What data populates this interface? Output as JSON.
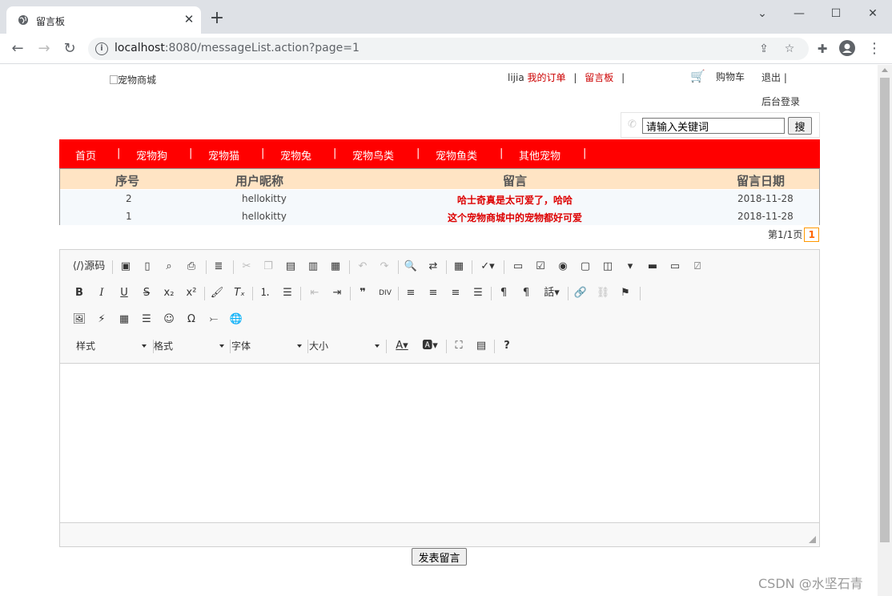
{
  "browser": {
    "tab_title": "留言板",
    "url_host": "localhost",
    "url_path": ":8080/messageList.action?page=1"
  },
  "header": {
    "logo_alt": "宠物商城",
    "username": "lijia",
    "my_orders": "我的订单",
    "message_board": "留言板",
    "cart": "购物车",
    "logout": "退出",
    "admin_login": "后台登录",
    "separator": "|"
  },
  "search": {
    "value": "请输入关键词",
    "button": "搜"
  },
  "menu": [
    "首页",
    "宠物狗",
    "宠物猫",
    "宠物兔",
    "宠物鸟类",
    "宠物鱼类",
    "其他宠物"
  ],
  "table": {
    "headers": [
      "序号",
      "用户昵称",
      "留言",
      "留言日期"
    ],
    "rows": [
      {
        "id": "2",
        "user": "hellokitty",
        "message": "哈士奇真是太可爱了，哈哈",
        "date": "2018-11-28"
      },
      {
        "id": "1",
        "user": "hellokitty",
        "message": "这个宠物商城中的宠物都好可爱",
        "date": "2018-11-28"
      }
    ]
  },
  "pager": {
    "text": "第1/1页",
    "current": "1"
  },
  "editor": {
    "source_label": "源码",
    "combos": [
      "样式",
      "格式",
      "字体",
      "大小"
    ]
  },
  "submit_label": "发表留言",
  "watermark": "CSDN @水坚石青"
}
